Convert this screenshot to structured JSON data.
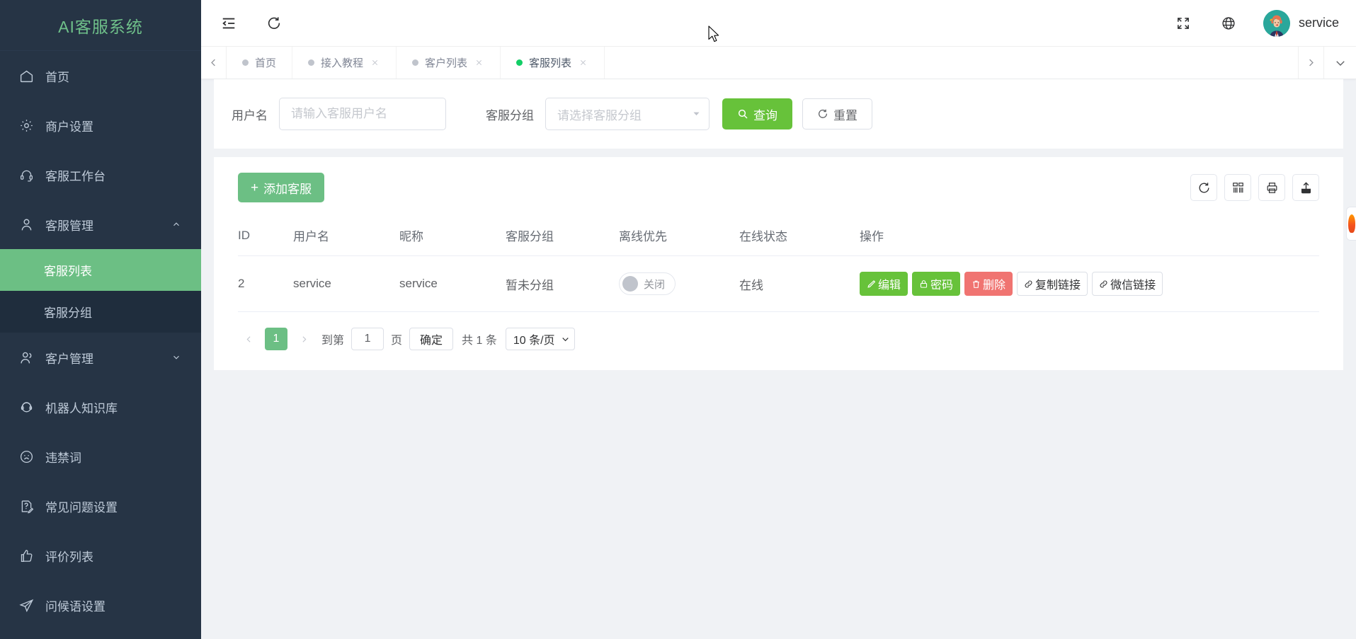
{
  "sidebar": {
    "brand": "AI客服系统",
    "items": [
      {
        "label": "首页",
        "icon": "home-icon",
        "expandable": false
      },
      {
        "label": "商户设置",
        "icon": "gear-icon",
        "expandable": false
      },
      {
        "label": "客服工作台",
        "icon": "headset-icon",
        "expandable": false
      },
      {
        "label": "客服管理",
        "icon": "user-icon",
        "expandable": true,
        "expanded": true
      },
      {
        "label": "客户管理",
        "icon": "users-icon",
        "expandable": true,
        "expanded": false
      },
      {
        "label": "机器人知识库",
        "icon": "robot-headset-icon",
        "expandable": false
      },
      {
        "label": "违禁词",
        "icon": "sad-face-icon",
        "expandable": false
      },
      {
        "label": "常见问题设置",
        "icon": "question-edit-icon",
        "expandable": false
      },
      {
        "label": "评价列表",
        "icon": "thumbs-up-icon",
        "expandable": false
      },
      {
        "label": "问候语设置",
        "icon": "paper-plane-icon",
        "expandable": false
      }
    ],
    "submenu": [
      {
        "label": "客服列表",
        "active": true
      },
      {
        "label": "客服分组",
        "active": false
      }
    ]
  },
  "topbar": {
    "collapse_icon": "menu-collapse-icon",
    "refresh_icon": "refresh-icon",
    "fullscreen_icon": "fullscreen-icon",
    "language_icon": "globe-icon",
    "username": "service",
    "avatar_icon": "user-avatar-icon"
  },
  "tabbar": {
    "prev_icon": "chevron-left-icon",
    "next_icon": "chevron-right-icon",
    "dropdown_icon": "chevron-down-icon",
    "tabs": [
      {
        "label": "首页",
        "active": false,
        "closable": false
      },
      {
        "label": "接入教程",
        "active": false,
        "closable": true
      },
      {
        "label": "客户列表",
        "active": false,
        "closable": true
      },
      {
        "label": "客服列表",
        "active": true,
        "closable": true
      }
    ]
  },
  "filter": {
    "username_label": "用户名",
    "username_value": "",
    "username_placeholder": "请输入客服用户名",
    "group_label": "客服分组",
    "group_value": "",
    "group_placeholder": "请选择客服分组",
    "search_button": "查询",
    "search_icon": "search-icon",
    "reset_button": "重置",
    "reset_icon": "refresh-icon"
  },
  "table": {
    "add_button": "添加客服",
    "add_icon": "plus-icon",
    "tools": [
      {
        "name": "refresh-icon",
        "title": "刷新"
      },
      {
        "name": "columns-icon",
        "title": "列设置"
      },
      {
        "name": "print-icon",
        "title": "打印"
      },
      {
        "name": "export-icon",
        "title": "导出"
      }
    ],
    "columns": [
      "ID",
      "用户名",
      "昵称",
      "客服分组",
      "离线优先",
      "在线状态",
      "操作"
    ],
    "rows": [
      {
        "id": "2",
        "username": "service",
        "nickname": "service",
        "group": "暂未分组",
        "offline_priority": "关闭",
        "offline_priority_on": false,
        "status": "在线",
        "actions": [
          {
            "label": "编辑",
            "style": "green",
            "icon": "pencil-icon"
          },
          {
            "label": "密码",
            "style": "green",
            "icon": "lock-icon"
          },
          {
            "label": "删除",
            "style": "red",
            "icon": "trash-icon"
          },
          {
            "label": "复制链接",
            "style": "white",
            "icon": "link-icon"
          },
          {
            "label": "微信链接",
            "style": "white",
            "icon": "link-icon"
          }
        ]
      }
    ]
  },
  "pagination": {
    "prev_icon": "chevron-left-icon",
    "next_icon": "chevron-right-icon",
    "current_page": "1",
    "jump_prefix": "到第",
    "jump_value": "1",
    "jump_suffix": "页",
    "confirm_button": "确定",
    "total_text": "共 1 条",
    "page_size": "10 条/页",
    "page_size_icon": "chevron-down-icon"
  },
  "colors": {
    "accent_green": "#67c23a",
    "sidebar_bg": "#263445",
    "submenu_bg": "#1f2d3d",
    "active_green": "#6cbf84",
    "danger_red": "#f07471",
    "tab_active_dot": "#13ce66"
  }
}
